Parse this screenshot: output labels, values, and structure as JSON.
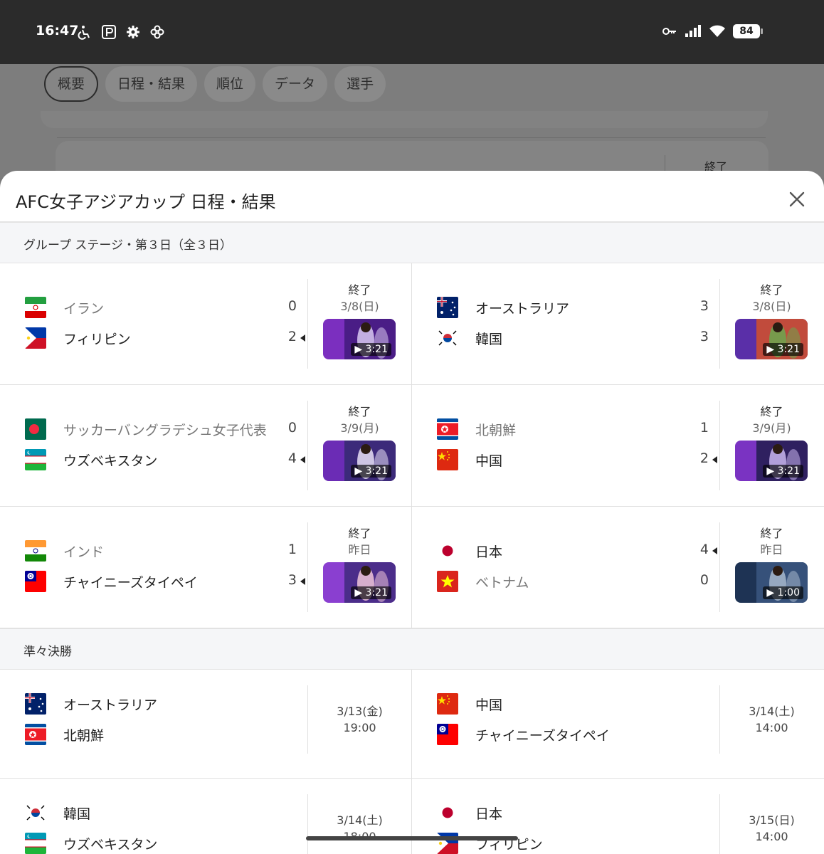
{
  "status_bar": {
    "time": "16:47",
    "battery": "84",
    "left_icons": [
      "accessibility-icon",
      "app-p-icon",
      "gear-icon",
      "pinwheel-icon"
    ],
    "right_icons": [
      "key-icon",
      "signal-icon",
      "wifi-icon"
    ]
  },
  "background": {
    "tabs": [
      "概要",
      "日程・結果",
      "順位",
      "データ",
      "選手"
    ],
    "active_tab": 0,
    "peek_status": "終了"
  },
  "sheet": {
    "title": "AFC女子アジアカップ 日程・結果",
    "close_icon": "close-icon"
  },
  "sections": [
    {
      "title": "グループ ステージ・第３日（全３日）",
      "rows": [
        [
          {
            "status": "終了",
            "date": "3/8(日)",
            "home": {
              "name": "イラン",
              "flag": "iran",
              "score": "0",
              "winner": false
            },
            "away": {
              "name": "フィリピン",
              "flag": "philippines",
              "score": "2",
              "winner": true
            },
            "video": {
              "duration": "3:21",
              "overlay": "0-2"
            }
          },
          {
            "status": "終了",
            "date": "3/8(日)",
            "home": {
              "name": "オーストラリア",
              "flag": "australia",
              "score": "3",
              "winner": false
            },
            "away": {
              "name": "韓国",
              "flag": "korea",
              "score": "3",
              "winner": false
            },
            "video": {
              "duration": "3:21",
              "overlay": "3-3"
            }
          }
        ],
        [
          {
            "status": "終了",
            "date": "3/9(月)",
            "home": {
              "name": "サッカーバングラデシュ女子代表",
              "flag": "bangladesh",
              "score": "0",
              "winner": false
            },
            "away": {
              "name": "ウズベキスタン",
              "flag": "uzbekistan",
              "score": "4",
              "winner": true
            },
            "video": {
              "duration": "3:21",
              "overlay": "0-4"
            }
          },
          {
            "status": "終了",
            "date": "3/9(月)",
            "home": {
              "name": "北朝鮮",
              "flag": "northkorea",
              "score": "1",
              "winner": false
            },
            "away": {
              "name": "中国",
              "flag": "china",
              "score": "2",
              "winner": true
            },
            "video": {
              "duration": "3:21",
              "overlay": "1-2"
            }
          }
        ],
        [
          {
            "status": "終了",
            "date": "昨日",
            "home": {
              "name": "インド",
              "flag": "india",
              "score": "1",
              "winner": false
            },
            "away": {
              "name": "チャイニーズタイペイ",
              "flag": "taipei",
              "score": "3",
              "winner": true
            },
            "video": {
              "duration": "3:21",
              "overlay": "1-3"
            }
          },
          {
            "status": "終了",
            "date": "昨日",
            "home": {
              "name": "日本",
              "flag": "japan",
              "score": "4",
              "winner": true
            },
            "away": {
              "name": "ベトナム",
              "flag": "vietnam",
              "score": "0",
              "winner": false
            },
            "video": {
              "duration": "1:00",
              "overlay": ""
            }
          }
        ]
      ]
    },
    {
      "title": "準々決勝",
      "rows": [
        [
          {
            "kickoff_date": "3/13(金)",
            "kickoff_time": "19:00",
            "home": {
              "name": "オーストラリア",
              "flag": "australia"
            },
            "away": {
              "name": "北朝鮮",
              "flag": "northkorea"
            }
          },
          {
            "kickoff_date": "3/14(土)",
            "kickoff_time": "14:00",
            "home": {
              "name": "中国",
              "flag": "china"
            },
            "away": {
              "name": "チャイニーズタイペイ",
              "flag": "taipei"
            }
          }
        ],
        [
          {
            "kickoff_date": "3/14(土)",
            "kickoff_time": "18:00",
            "home": {
              "name": "韓国",
              "flag": "korea"
            },
            "away": {
              "name": "ウズベキスタン",
              "flag": "uzbekistan"
            }
          },
          {
            "kickoff_date": "3/15(日)",
            "kickoff_time": "14:00",
            "home": {
              "name": "日本",
              "flag": "japan"
            },
            "away": {
              "name": "フィリピン",
              "flag": "philippines"
            }
          }
        ]
      ]
    }
  ]
}
